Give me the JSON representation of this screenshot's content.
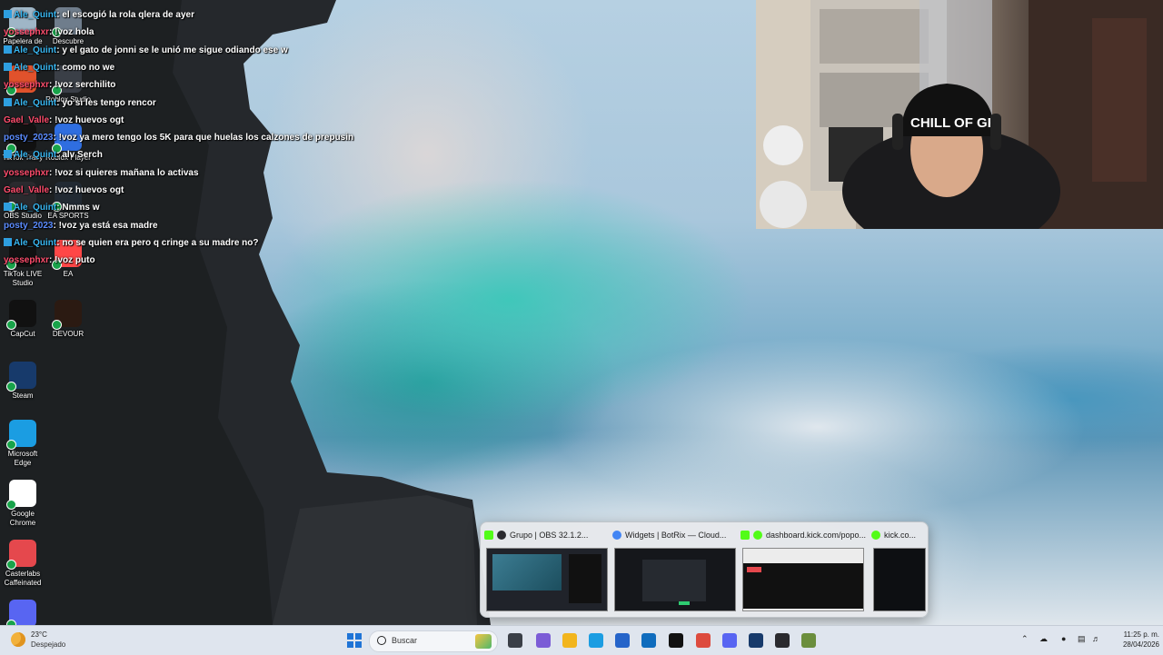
{
  "desktop": {
    "icons": [
      {
        "label": "Papelera de",
        "icon": "recycle-bin-icon",
        "color": "#9fb6c7"
      },
      {
        "label": "Descubre",
        "icon": "discover-icon",
        "color": "#6f7d8c"
      },
      {
        "label": "",
        "icon": "office-icon",
        "color": "#e1522c"
      },
      {
        "label": "Roblox Studio",
        "icon": "roblox-studio-icon",
        "color": "#3a3f47"
      },
      {
        "label": "TikTok Tracy",
        "icon": "tiktok-icon",
        "color": "#111111"
      },
      {
        "label": "Roblox Player",
        "icon": "roblox-player-icon",
        "color": "#2f6ee0"
      },
      {
        "label": "OBS Studio",
        "icon": "obs-icon",
        "color": "#2a2a2e"
      },
      {
        "label": "EA SPORTS",
        "icon": "ea-sports-icon",
        "color": "#222a33"
      },
      {
        "label": "TikTok LIVE Studio",
        "icon": "tiktok-live-icon",
        "color": "#111111"
      },
      {
        "label": "EA",
        "icon": "ea-icon",
        "color": "#ff4747"
      },
      {
        "label": "CapCut",
        "icon": "capcut-icon",
        "color": "#111111"
      },
      {
        "label": "DEVOUR",
        "icon": "devour-icon",
        "color": "#2b1a12"
      },
      {
        "label": "Steam",
        "icon": "steam-icon",
        "color": "#173a6b"
      },
      {
        "label": "Microsoft Edge",
        "icon": "edge-icon",
        "color": "#1b9de2"
      },
      {
        "label": "Google Chrome",
        "icon": "chrome-icon",
        "color": "#ffffff"
      },
      {
        "label": "Casterlabs Caffeinated",
        "icon": "casterlabs-icon",
        "color": "#e5484d"
      },
      {
        "label": "",
        "icon": "discord-icon",
        "color": "#5865f2"
      }
    ]
  },
  "chat": {
    "messages": [
      {
        "user": "Ale_Quint",
        "text": ": el escogió la rola qlera de ayer",
        "color": "#38b6f0",
        "badge": true
      },
      {
        "user": "yossephxr",
        "text": ": !voz hola",
        "color": "#ff4d6d",
        "badge": false
      },
      {
        "user": "Ale_Quint",
        "text": ": y el gato de jonni se le unió me sigue odiando ese w",
        "color": "#38b6f0",
        "badge": true
      },
      {
        "user": "Ale_Quint",
        "text": ": como no we",
        "color": "#38b6f0",
        "badge": true
      },
      {
        "user": "yossephxr",
        "text": ": !voz serchilito",
        "color": "#ff4d6d",
        "badge": false
      },
      {
        "user": "Ale_Quint",
        "text": ": yo si les tengo rencor",
        "color": "#38b6f0",
        "badge": true
      },
      {
        "user": "Gael_Valle",
        "text": ": !voz huevos ogt",
        "color": "#ff4d6d",
        "badge": false
      },
      {
        "user": "posty_2023",
        "text": ": !voz ya mero tengo los 5K para que huelas los calzones de prepusin",
        "color": "#5b8cff",
        "badge": false
      },
      {
        "user": "Ale_Quint",
        "text": ": alv Serch",
        "color": "#38b6f0",
        "badge": true
      },
      {
        "user": "yossephxr",
        "text": ": !voz si quieres mañana lo activas",
        "color": "#ff4d6d",
        "badge": false
      },
      {
        "user": "Gael_Valle",
        "text": ": !voz huevos ogt",
        "color": "#ff4d6d",
        "badge": false
      },
      {
        "user": "Ale_Quint",
        "text": ": Nmms w",
        "color": "#38b6f0",
        "badge": true
      },
      {
        "user": "posty_2023",
        "text": ": !voz ya está esa madre",
        "color": "#5b8cff",
        "badge": false
      },
      {
        "user": "Ale_Quint",
        "text": ": no se quien era pero q cringe a su madre no?",
        "color": "#38b6f0",
        "badge": true
      },
      {
        "user": "yossephxr",
        "text": ": !voz puto",
        "color": "#ff4d6d",
        "badge": false
      }
    ]
  },
  "webcam": {
    "cap_text": "CHILL OF GR"
  },
  "task_previews": [
    {
      "title": "Grupo | OBS 32.1.2...",
      "fav_color": "#2a2a2e",
      "kick_color": "#53fc18"
    },
    {
      "title": "Widgets | BotRix — Cloud...",
      "fav_color": "#4285f4",
      "kick_color": ""
    },
    {
      "title": "dashboard.kick.com/popo...",
      "fav_color": "#53fc18",
      "kick_color": "#53fc18"
    },
    {
      "title": "kick.co...",
      "fav_color": "#53fc18",
      "kick_color": ""
    }
  ],
  "taskbar": {
    "weather_temp": "23°C",
    "weather_desc": "Despejado",
    "search_placeholder": "Buscar",
    "apps": [
      {
        "icon": "start-icon",
        "color": "#1f74d6"
      },
      {
        "icon": "task-view-icon",
        "color": "#3a3f47"
      },
      {
        "icon": "copilot-icon",
        "color": "#7b5cd6"
      },
      {
        "icon": "file-explorer-icon",
        "color": "#f2b51d"
      },
      {
        "icon": "edge-icon",
        "color": "#1b9de2"
      },
      {
        "icon": "store-icon",
        "color": "#2564c9"
      },
      {
        "icon": "outlook-icon",
        "color": "#0f6cbd"
      },
      {
        "icon": "tiktok-icon",
        "color": "#111111"
      },
      {
        "icon": "chrome-icon",
        "color": "#dd4b3e"
      },
      {
        "icon": "discord-icon",
        "color": "#5865f2"
      },
      {
        "icon": "steam-icon",
        "color": "#173a6b"
      },
      {
        "icon": "obs-icon",
        "color": "#2a2a2e"
      },
      {
        "icon": "minecraft-icon",
        "color": "#6b8e3d"
      }
    ],
    "time": "11:25 p. m.",
    "date": "28/04/2026"
  }
}
